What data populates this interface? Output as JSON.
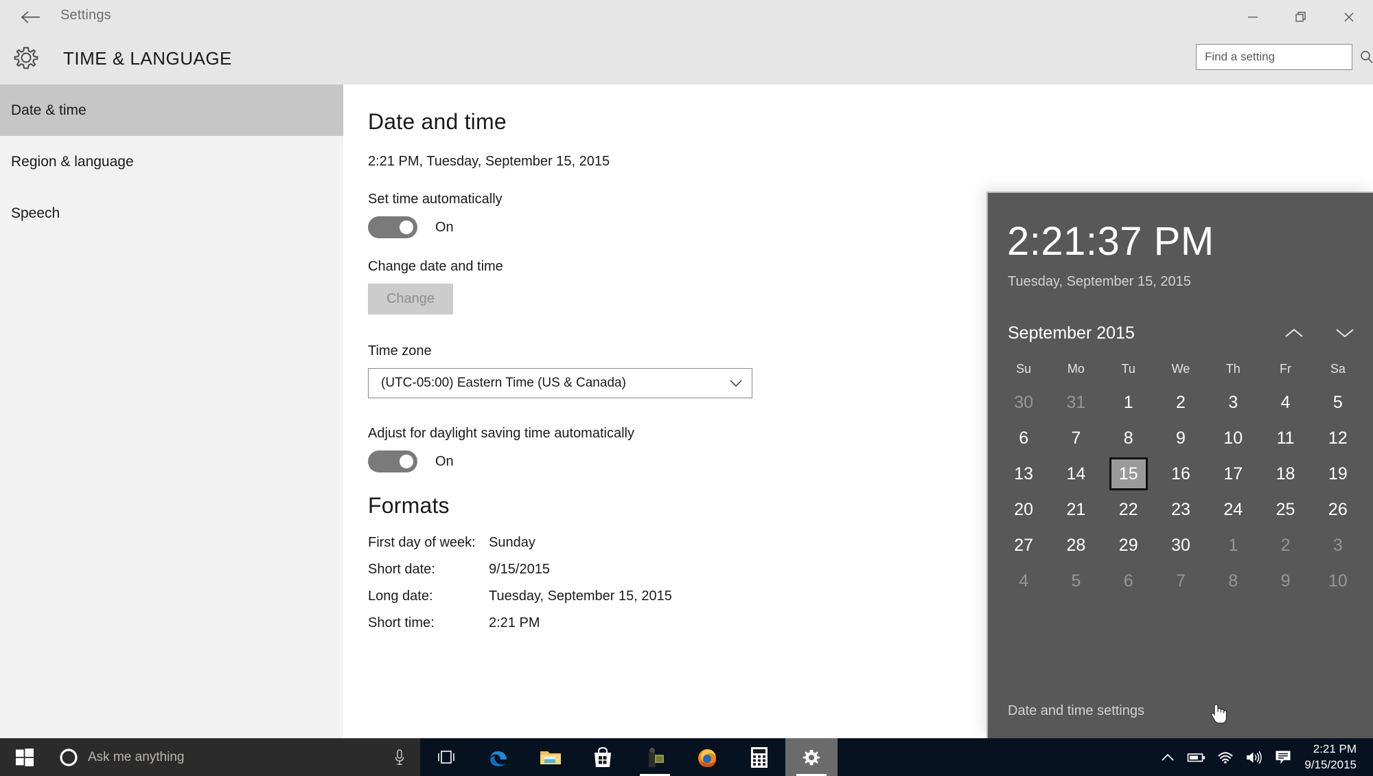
{
  "window": {
    "app_title": "Settings",
    "back_icon": "back-arrow-icon",
    "minimize_icon": "minimize-icon",
    "restore_icon": "restore-icon",
    "close_icon": "close-icon"
  },
  "header": {
    "gear_icon": "gear-icon",
    "page_title": "TIME & LANGUAGE",
    "search": {
      "placeholder": "Find a setting",
      "value": "",
      "icon": "search-icon"
    }
  },
  "sidebar": {
    "items": [
      {
        "label": "Date & time",
        "selected": true
      },
      {
        "label": "Region & language",
        "selected": false
      },
      {
        "label": "Speech",
        "selected": false
      }
    ]
  },
  "main": {
    "heading": "Date and time",
    "current_datetime": "2:21 PM, Tuesday, September 15, 2015",
    "set_time_auto": {
      "label": "Set time automatically",
      "state": "On"
    },
    "change_date_time": {
      "label": "Change date and time",
      "button_label": "Change",
      "disabled": true
    },
    "time_zone": {
      "label": "Time zone",
      "value": "(UTC-05:00) Eastern Time (US & Canada)",
      "chevron_icon": "chevron-down-icon"
    },
    "dst": {
      "label": "Adjust for daylight saving time automatically",
      "state": "On"
    },
    "formats": {
      "heading": "Formats",
      "rows": [
        {
          "key": "First day of week:",
          "value": "Sunday"
        },
        {
          "key": "Short date:",
          "value": "9/15/2015"
        },
        {
          "key": "Long date:",
          "value": "Tuesday, September 15, 2015"
        },
        {
          "key": "Short time:",
          "value": "2:21 PM"
        }
      ]
    }
  },
  "flyout": {
    "time": "2:21:37 PM",
    "date": "Tuesday, September 15, 2015",
    "month_year": "September 2015",
    "prev_icon": "chevron-up-icon",
    "next_icon": "chevron-down-icon",
    "weekdays": [
      "Su",
      "Mo",
      "Tu",
      "We",
      "Th",
      "Fr",
      "Sa"
    ],
    "weeks": [
      [
        {
          "d": "30",
          "muted": true
        },
        {
          "d": "31",
          "muted": true
        },
        {
          "d": "1",
          "muted": false
        },
        {
          "d": "2",
          "muted": false
        },
        {
          "d": "3",
          "muted": false
        },
        {
          "d": "4",
          "muted": false
        },
        {
          "d": "5",
          "muted": false
        }
      ],
      [
        {
          "d": "6",
          "muted": false
        },
        {
          "d": "7",
          "muted": false
        },
        {
          "d": "8",
          "muted": false
        },
        {
          "d": "9",
          "muted": false
        },
        {
          "d": "10",
          "muted": false
        },
        {
          "d": "11",
          "muted": false
        },
        {
          "d": "12",
          "muted": false
        }
      ],
      [
        {
          "d": "13",
          "muted": false
        },
        {
          "d": "14",
          "muted": false
        },
        {
          "d": "15",
          "muted": false,
          "today": true
        },
        {
          "d": "16",
          "muted": false
        },
        {
          "d": "17",
          "muted": false
        },
        {
          "d": "18",
          "muted": false
        },
        {
          "d": "19",
          "muted": false
        }
      ],
      [
        {
          "d": "20",
          "muted": false
        },
        {
          "d": "21",
          "muted": false
        },
        {
          "d": "22",
          "muted": false
        },
        {
          "d": "23",
          "muted": false
        },
        {
          "d": "24",
          "muted": false
        },
        {
          "d": "25",
          "muted": false
        },
        {
          "d": "26",
          "muted": false
        }
      ],
      [
        {
          "d": "27",
          "muted": false
        },
        {
          "d": "28",
          "muted": false
        },
        {
          "d": "29",
          "muted": false
        },
        {
          "d": "30",
          "muted": false
        },
        {
          "d": "1",
          "muted": true
        },
        {
          "d": "2",
          "muted": true
        },
        {
          "d": "3",
          "muted": true
        }
      ],
      [
        {
          "d": "4",
          "muted": true
        },
        {
          "d": "5",
          "muted": true
        },
        {
          "d": "6",
          "muted": true
        },
        {
          "d": "7",
          "muted": true
        },
        {
          "d": "8",
          "muted": true
        },
        {
          "d": "9",
          "muted": true
        },
        {
          "d": "10",
          "muted": true
        }
      ]
    ],
    "settings_link": "Date and time settings"
  },
  "taskbar": {
    "start_icon": "windows-start-icon",
    "cortana": {
      "ring_icon": "cortana-circle-icon",
      "placeholder": "Ask me anything",
      "value": "",
      "mic_icon": "microphone-icon"
    },
    "apps": [
      {
        "icon": "task-view-icon",
        "name": "task-view",
        "active": false,
        "running": false
      },
      {
        "icon": "edge-icon",
        "name": "microsoft-edge",
        "active": false,
        "running": false
      },
      {
        "icon": "file-explorer-icon",
        "name": "file-explorer",
        "active": false,
        "running": false
      },
      {
        "icon": "store-icon",
        "name": "store",
        "active": false,
        "running": false
      },
      {
        "icon": "dark-app-icon",
        "name": "pinned-app",
        "active": false,
        "running": true
      },
      {
        "icon": "firefox-icon",
        "name": "firefox",
        "active": false,
        "running": false
      },
      {
        "icon": "calculator-icon",
        "name": "calculator",
        "active": false,
        "running": false
      },
      {
        "icon": "settings-gear-icon",
        "name": "settings",
        "active": true,
        "running": true
      }
    ],
    "tray": {
      "icons": [
        {
          "icon": "chevron-up-icon",
          "name": "show-hidden-icons"
        },
        {
          "icon": "battery-icon",
          "name": "battery"
        },
        {
          "icon": "wifi-icon",
          "name": "network"
        },
        {
          "icon": "volume-icon",
          "name": "volume"
        },
        {
          "icon": "action-center-icon",
          "name": "action-center"
        }
      ],
      "time": "2:21 PM",
      "date": "9/15/2015"
    }
  },
  "colors": {
    "window_chrome": "#e6e6e6",
    "sidebar_bg": "#f2f2f2",
    "sidebar_selected": "#c6c6c6",
    "flyout_bg": "#585858",
    "taskbar_bg": "#06121f",
    "cortana_bg": "#2b2b2b",
    "toggle_on": "#7a7a7a",
    "accent_text": "#1a1a1a"
  }
}
